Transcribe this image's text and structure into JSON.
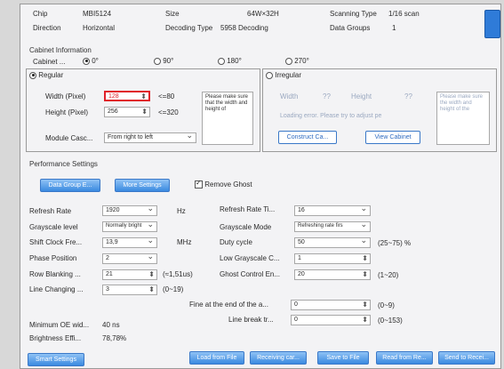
{
  "header": {
    "chip_label": "Chip",
    "chip_value": "MBI5124",
    "size_label": "Size",
    "size_value": "64W×32H",
    "scan_label": "Scanning Type",
    "scan_value": "1/16 scan",
    "direction_label": "Direction",
    "direction_value": "Horizontal",
    "decoding_label": "Decoding Type",
    "decoding_value": "5958 Decoding",
    "groups_label": "Data Groups",
    "groups_value": "1"
  },
  "cabinet": {
    "section_title": "Cabinet Information",
    "cabinet_label": "Cabinet ...",
    "angles": [
      "0°",
      "90°",
      "180°",
      "270°"
    ],
    "regular": {
      "title": "Regular",
      "width_label": "Width (Pixel)",
      "width_value": "128",
      "width_limit": "<=80",
      "height_label": "Height (Pixel)",
      "height_value": "256",
      "height_limit": "<=320",
      "module_label": "Module Casc...",
      "module_value": "From right to left",
      "note": "Please make sure that the width and height of"
    },
    "irregular": {
      "title": "Irregular",
      "width_label": "Width",
      "width_value": "??",
      "height_label": "Height",
      "height_value": "??",
      "error_text": "Loading error. Please try to adjust pe",
      "construct_btn": "Construct Ca...",
      "view_btn": "View Cabinet",
      "note": "Please make sure the width and height of the"
    }
  },
  "performance": {
    "section_title": "Performance Settings",
    "data_group_btn": "Data Group E...",
    "more_settings_btn": "More Settings",
    "remove_ghost_label": "Remove Ghost",
    "refresh_rate_label": "Refresh Rate",
    "refresh_rate_value": "1920",
    "refresh_rate_unit": "Hz",
    "grayscale_level_label": "Grayscale level",
    "grayscale_level_value": "Normally bright",
    "shift_clock_label": "Shift Clock Fre...",
    "shift_clock_value": "13,9",
    "shift_clock_unit": "MHz",
    "phase_label": "Phase Position",
    "phase_value": "2",
    "row_blanking_label": "Row Blanking ...",
    "row_blanking_value": "21",
    "row_blanking_unit": "(≈1,51us)",
    "line_changing_label": "Line Changing ...",
    "line_changing_value": "3",
    "line_changing_unit": "(0~19)",
    "refresh_rate_ti_label": "Refresh Rate Ti...",
    "refresh_rate_ti_value": "16",
    "grayscale_mode_label": "Grayscale Mode",
    "grayscale_mode_value": "Refreshing rate firs",
    "duty_label": "Duty cycle",
    "duty_value": "50",
    "duty_unit": "(25~75) %",
    "low_gray_label": "Low Grayscale C...",
    "low_gray_value": "1",
    "ghost_label": "Ghost Control En...",
    "ghost_value": "20",
    "ghost_unit": "(1~20)",
    "fine_label": "Fine at the end of the a...",
    "fine_value": "0",
    "fine_unit": "(0~9)",
    "line_break_label": "Line break tr...",
    "line_break_value": "0",
    "line_break_unit": "(0~153)",
    "min_oe_label": "Minimum OE wid...",
    "min_oe_value": "40 ns",
    "brightness_label": "Brightness Effi...",
    "brightness_value": "78,78%"
  },
  "footer": {
    "smart_btn": "Smart Settings",
    "load_btn": "Load from File",
    "receiving_btn": "Receiving car...",
    "save_btn": "Save to File",
    "read_btn": "Read from Re...",
    "send_btn": "Send to Recei..."
  },
  "colors": {
    "accent_blue": "#3a8ae0",
    "highlight_red": "#e0202a"
  }
}
